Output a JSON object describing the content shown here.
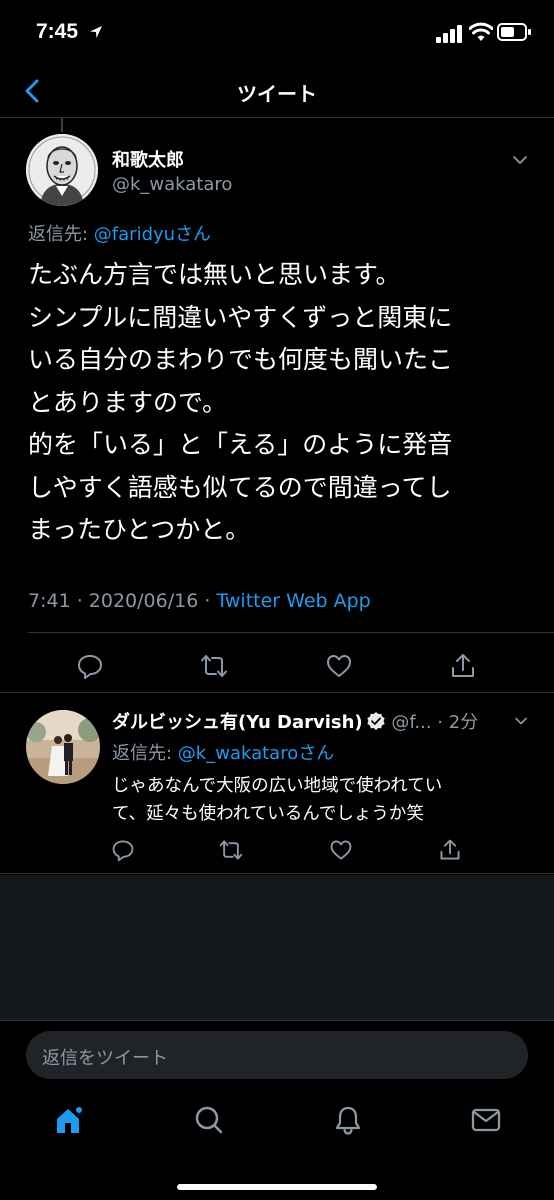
{
  "status_bar": {
    "time": "7:45"
  },
  "nav": {
    "title": "ツイート"
  },
  "tweet": {
    "author_name": "和歌太郎",
    "author_handle": "@k_wakataro",
    "reply_to_label": "返信先: ",
    "reply_to_mention": "@faridyuさん",
    "text_lines": [
      "たぶん方言では無いと思います。",
      "シンプルに間違いやすくずっと関東に",
      "いる自分のまわりでも何度も聞いたこ",
      "とありますので。",
      "的を「いる」と「える」のように発音",
      "しやすく語感も似てるので間違ってし",
      "まったひとつかと。"
    ],
    "timestamp": "7:41 · 2020/06/16 · ",
    "source_app": "Twitter Web App"
  },
  "reply": {
    "author_name": "ダルビッシュ有(Yu Darvish)",
    "author_handle": " @f...",
    "time_ago": " · 2分",
    "reply_to_label": "返信先: ",
    "reply_to_mention": "@k_wakataroさん",
    "text_lines": [
      "じゃあなんで大阪の広い地域で使われてい",
      "て、延々も使われているんでしょうか笑"
    ]
  },
  "compose": {
    "placeholder": "返信をツイート"
  },
  "colors": {
    "accent": "#1d9bf0",
    "muted": "#8b98a5",
    "background": "#000000",
    "divider": "#2f3336"
  }
}
